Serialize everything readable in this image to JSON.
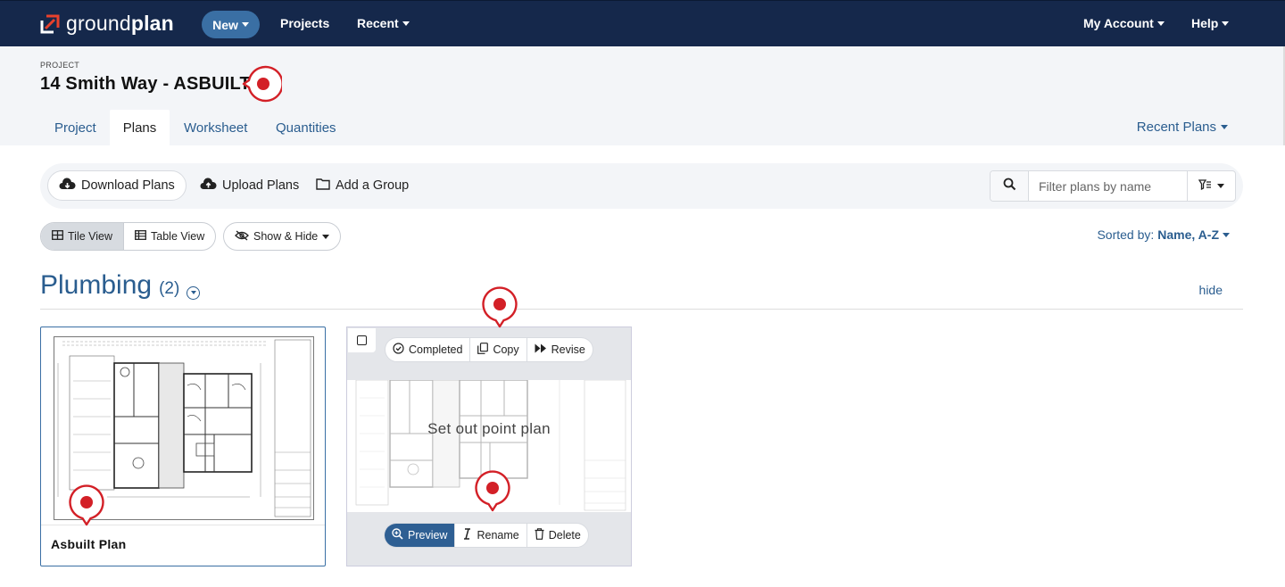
{
  "nav": {
    "logo_part1": "ground",
    "logo_part2": "plan",
    "new_label": "New",
    "projects_label": "Projects",
    "recent_label": "Recent",
    "account_label": "My Account",
    "help_label": "Help"
  },
  "project": {
    "label": "PROJECT",
    "title": "14 Smith Way - ASBUILT",
    "tabs": [
      {
        "label": "Project",
        "active": false
      },
      {
        "label": "Plans",
        "active": true
      },
      {
        "label": "Worksheet",
        "active": false
      },
      {
        "label": "Quantities",
        "active": false
      }
    ],
    "recent_plans_label": "Recent Plans"
  },
  "toolbar": {
    "download_label": "Download Plans",
    "upload_label": "Upload Plans",
    "add_group_label": "Add a Group",
    "filter_placeholder": "Filter plans by name"
  },
  "view": {
    "tile_label": "Tile View",
    "table_label": "Table View",
    "showhide_label": "Show & Hide",
    "sorted_prefix": "Sorted by:",
    "sorted_value": "Name, A-Z"
  },
  "group": {
    "name": "Plumbing",
    "count": "(2)",
    "hide_label": "hide"
  },
  "plans": [
    {
      "name": "Asbuilt Plan"
    },
    {
      "name": "Set out point plan",
      "top_actions": [
        "Completed",
        "Copy",
        "Revise"
      ],
      "bottom_actions": [
        "Preview",
        "Rename",
        "Delete"
      ]
    }
  ],
  "colors": {
    "navbar": "#15284b",
    "accent": "#2a5d8f",
    "pin": "#d32027"
  }
}
